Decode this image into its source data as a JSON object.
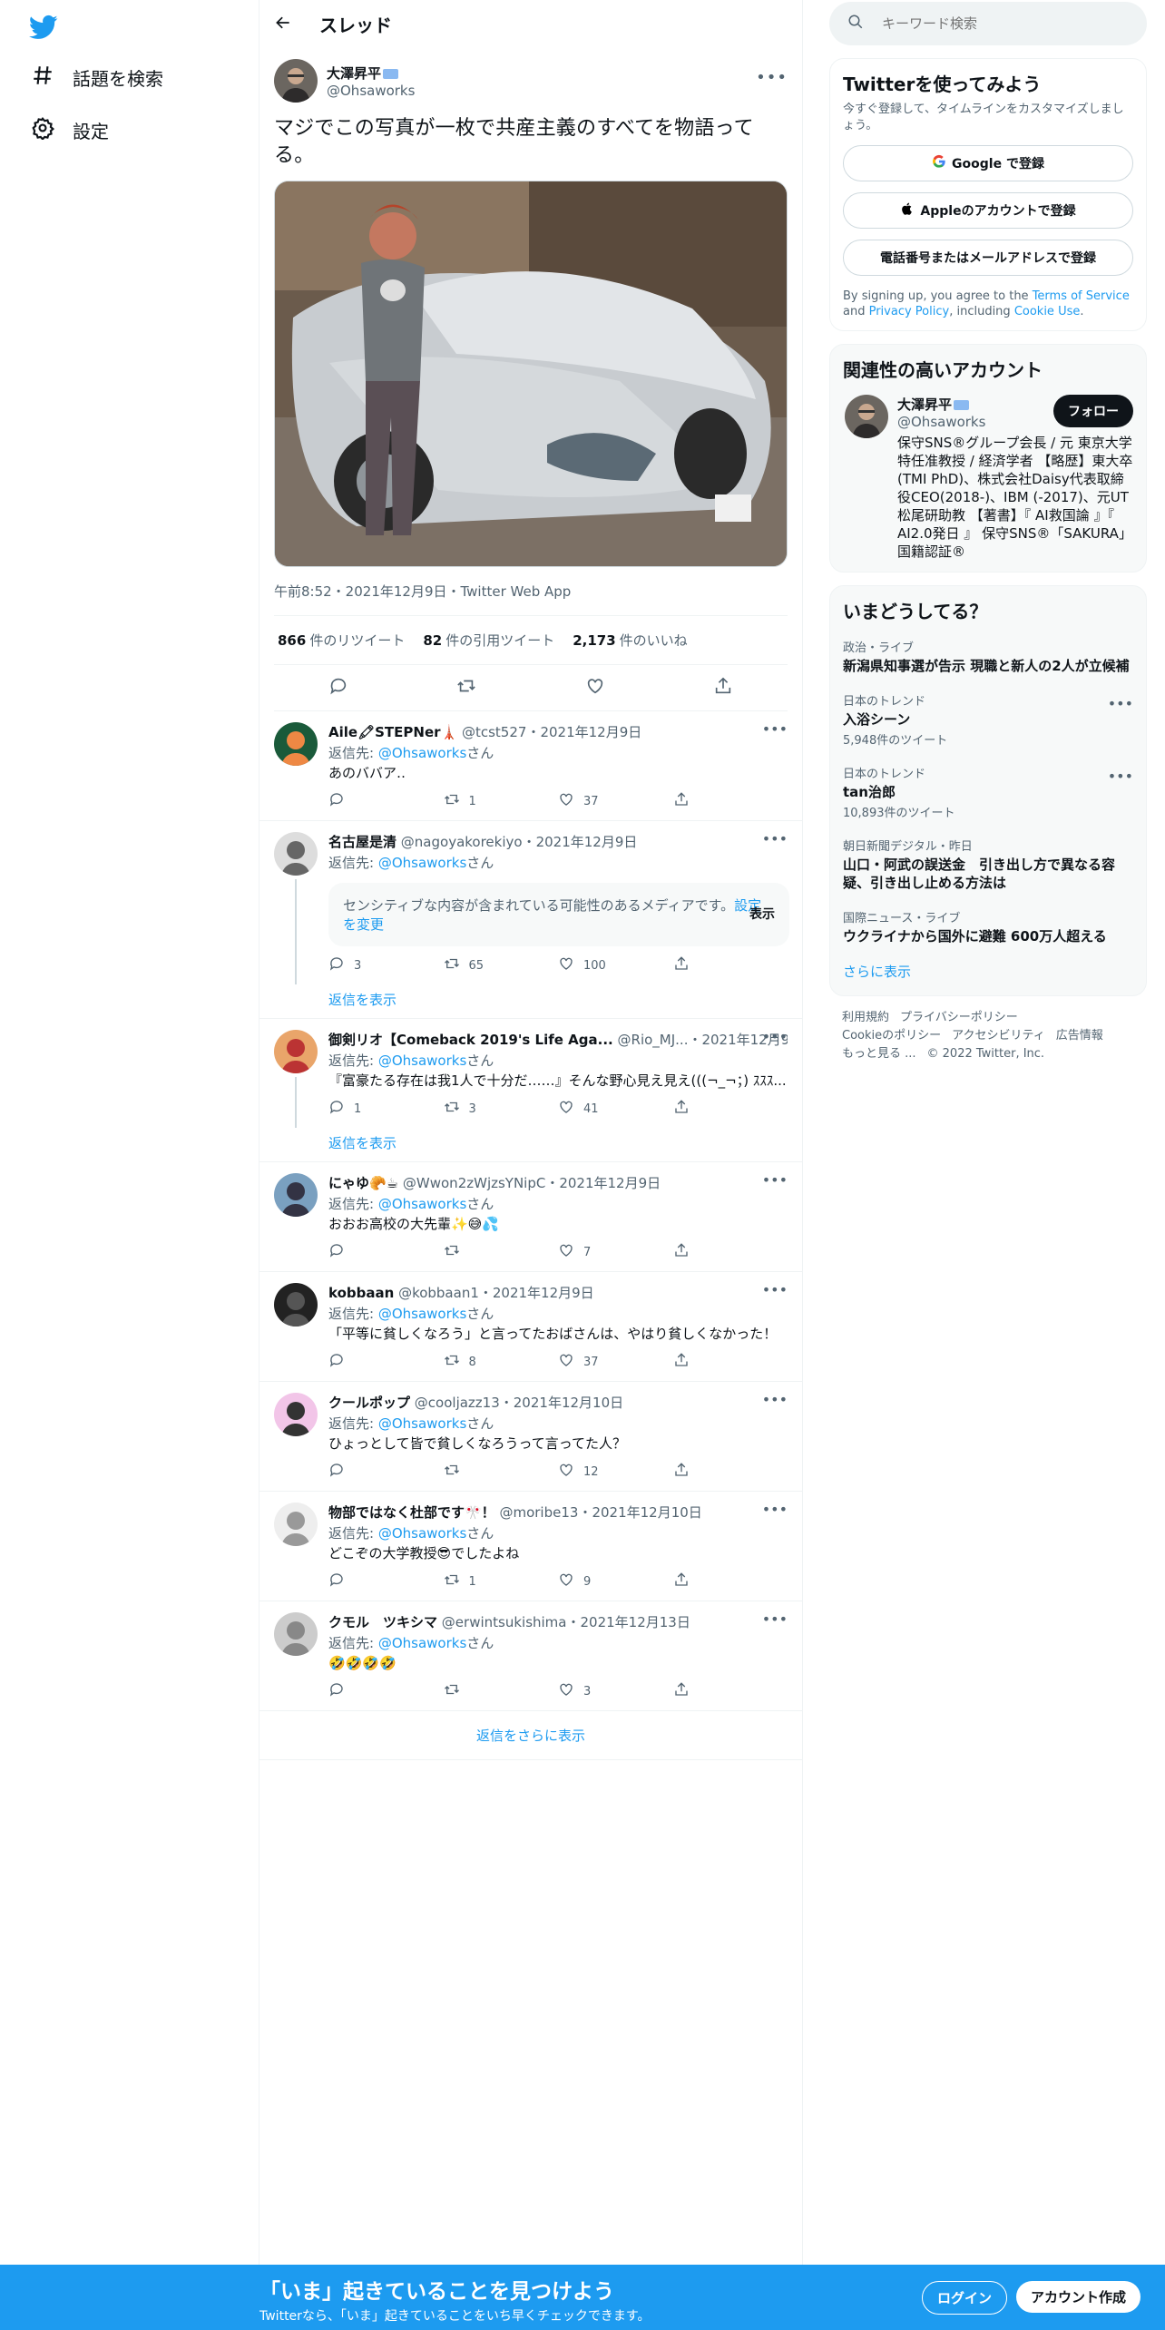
{
  "nav": {
    "explore": "話題を検索",
    "settings": "設定"
  },
  "header": {
    "title": "スレッド"
  },
  "main_tweet": {
    "name": "大澤昇平",
    "handle": "@Ohsaworks",
    "text": "マジでこの写真が一枚で共産主義のすべてを物語ってる。",
    "meta": "午前8:52・2021年12月9日・Twitter Web App",
    "retweets_count": "866",
    "retweets_label": "件のリツイート",
    "quotes_count": "82",
    "quotes_label": "件の引用ツイート",
    "likes_count": "2,173",
    "likes_label": "件のいいね"
  },
  "replies": [
    {
      "name": "Aile🖍STEPNer🗼",
      "handle": "@tcst527",
      "date": "・2021年12月9日",
      "to_label": "返信先:",
      "to_handle": "@Ohsaworks",
      "to_suffix": "さん",
      "text": "あのババア‥",
      "reply": "",
      "retweet": "1",
      "like": "37"
    },
    {
      "name": "名古屋是清",
      "handle": "@nagoyakorekiyo",
      "date": "・2021年12月9日",
      "to_label": "返信先:",
      "to_handle": "@Ohsaworks",
      "to_suffix": "さん",
      "text": "",
      "sensitive_text": "センシティブな内容が含まれている可能性のあるメディアです。",
      "sensitive_link": "設定を変更",
      "sensitive_show": "表示",
      "reply": "3",
      "retweet": "65",
      "like": "100"
    },
    {
      "name": "御剣リオ【Comeback 2019's Life Aga...",
      "handle": "@Rio_MJ...",
      "date": "・2021年12月9日",
      "to_label": "返信先:",
      "to_handle": "@Ohsaworks",
      "to_suffix": "さん",
      "text": "『富豪たる存在は我1人で十分だ……』そんな野心見え見え(((¬_¬；) ｽｽｽ...",
      "reply": "1",
      "retweet": "3",
      "like": "41"
    },
    {
      "name": "にゃゆ🥐☕",
      "handle": "@Wwon2zWjzsYNipC",
      "date": "・2021年12月9日",
      "to_label": "返信先:",
      "to_handle": "@Ohsaworks",
      "to_suffix": "さん",
      "text": "おおお高校の大先輩✨😅💦",
      "reply": "",
      "retweet": "",
      "like": "7"
    },
    {
      "name": "kobbaan",
      "handle": "@kobbaan1",
      "date": "・2021年12月9日",
      "to_label": "返信先:",
      "to_handle": "@Ohsaworks",
      "to_suffix": "さん",
      "text": "「平等に貧しくなろう」と言ってたおばさんは、やはり貧しくなかった！",
      "reply": "",
      "retweet": "8",
      "like": "37"
    },
    {
      "name": "クールポップ",
      "handle": "@cooljazz13",
      "date": "・2021年12月10日",
      "to_label": "返信先:",
      "to_handle": "@Ohsaworks",
      "to_suffix": "さん",
      "text": "ひょっとして皆で貧しくなろうって言ってた人？",
      "reply": "",
      "retweet": "",
      "like": "12"
    },
    {
      "name": "物部ではなく杜部です🎌！",
      "handle": "@moribe13",
      "date": "・2021年12月10日",
      "to_label": "返信先:",
      "to_handle": "@Ohsaworks",
      "to_suffix": "さん",
      "text": "どこぞの大学教授😎でしたよね",
      "reply": "",
      "retweet": "1",
      "like": "9"
    },
    {
      "name": "クモル　ツキシマ",
      "handle": "@erwintsukishima",
      "date": "・2021年12月13日",
      "to_label": "返信先:",
      "to_handle": "@Ohsaworks",
      "to_suffix": "さん",
      "text": "🤣🤣🤣🤣",
      "reply": "",
      "retweet": "",
      "like": "3"
    }
  ],
  "show_replies_label": "返信を表示",
  "more_replies_label": "返信をさらに表示",
  "search": {
    "placeholder": "キーワード検索"
  },
  "signup": {
    "title": "Twitterを使ってみよう",
    "subtitle": "今すぐ登録して、タイムラインをカスタマイズしましょう。",
    "google": "Google で登録",
    "apple": "Appleのアカウントで登録",
    "phone": "電話番号またはメールアドレスで登録",
    "legal_1": "By signing up, you agree to the ",
    "legal_terms": "Terms of Service",
    "legal_2": " and ",
    "legal_privacy": "Privacy Policy",
    "legal_3": ", including ",
    "legal_cookie": "Cookie Use",
    "legal_4": "."
  },
  "related": {
    "title": "関連性の高いアカウント",
    "name": "大澤昇平",
    "handle": "@Ohsaworks",
    "follow": "フォロー",
    "bio": "保守SNS®グループ会長 / 元 東京大学 特任准教授 / 経済学者 【略歴】東大卒(TMI PhD)、株式会社Daisy代表取締役CEO(2018-)、IBM (-2017)、元UT松尾研助教 【著書】『 AI救国論 』『 AI2.0発日 』 保守SNS®「SAKURA」 国籍認証®"
  },
  "trends": {
    "title": "いまどうしてる？",
    "items": [
      {
        "ctx": "政治・ライブ",
        "title": "新潟県知事選が告示 現職と新人の2人が立候補",
        "count": ""
      },
      {
        "ctx": "日本のトレンド",
        "title": "入浴シーン",
        "count": "5,948件のツイート"
      },
      {
        "ctx": "日本のトレンド",
        "title": "tan治郎",
        "count": "10,893件のツイート"
      },
      {
        "ctx": "朝日新聞デジタル",
        "ctx_time": "・昨日",
        "title": "山口・阿武の誤送金　引き出し方で異なる容疑、引き出し止める方法は",
        "count": ""
      },
      {
        "ctx": "国際ニュース・ライブ",
        "title": "ウクライナから国外に避難 600万人超える",
        "count": ""
      }
    ],
    "show_more": "さらに表示"
  },
  "footer": {
    "terms": "利用規約",
    "privacy": "プライバシーポリシー",
    "cookie": "Cookieのポリシー",
    "accessibility": "アクセシビリティ",
    "ads": "広告情報",
    "more": "もっと見る ...",
    "copyright": "© 2022 Twitter, Inc."
  },
  "bottombar": {
    "title": "「いま」起きていることを見つけよう",
    "subtitle": "Twitterなら、「いま」起きていることをいち早くチェックできます。",
    "login": "ログイン",
    "signup": "アカウント作成"
  },
  "colors": {
    "accent": "#1d9bf0",
    "text": "#0f1419",
    "muted": "#536471"
  }
}
